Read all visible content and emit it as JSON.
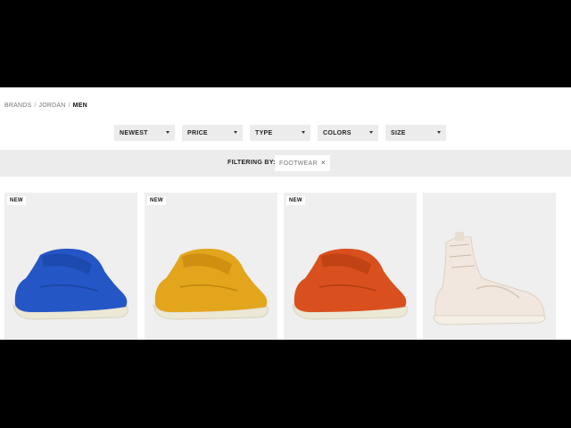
{
  "breadcrumb": {
    "items": [
      "BRANDS",
      "JORDAN"
    ],
    "current": "MEN",
    "separator": "/"
  },
  "filters": [
    {
      "label": "NEWEST"
    },
    {
      "label": "PRICE"
    },
    {
      "label": "TYPE"
    },
    {
      "label": "COLORS"
    },
    {
      "label": "SIZE"
    }
  ],
  "filter_bar": {
    "label": "FILTERING BY:",
    "chip": "FOOTWEAR",
    "chip_remove": "×"
  },
  "products": [
    {
      "badge": "NEW",
      "color": "#2456c6",
      "icon": "shoe-blue-icon"
    },
    {
      "badge": "NEW",
      "color": "#e3a51c",
      "icon": "shoe-yellow-icon"
    },
    {
      "badge": "NEW",
      "color": "#d9501e",
      "icon": "shoe-orange-icon"
    },
    {
      "badge": "",
      "color": "#f1e7de",
      "icon": "shoe-cream-icon"
    }
  ]
}
